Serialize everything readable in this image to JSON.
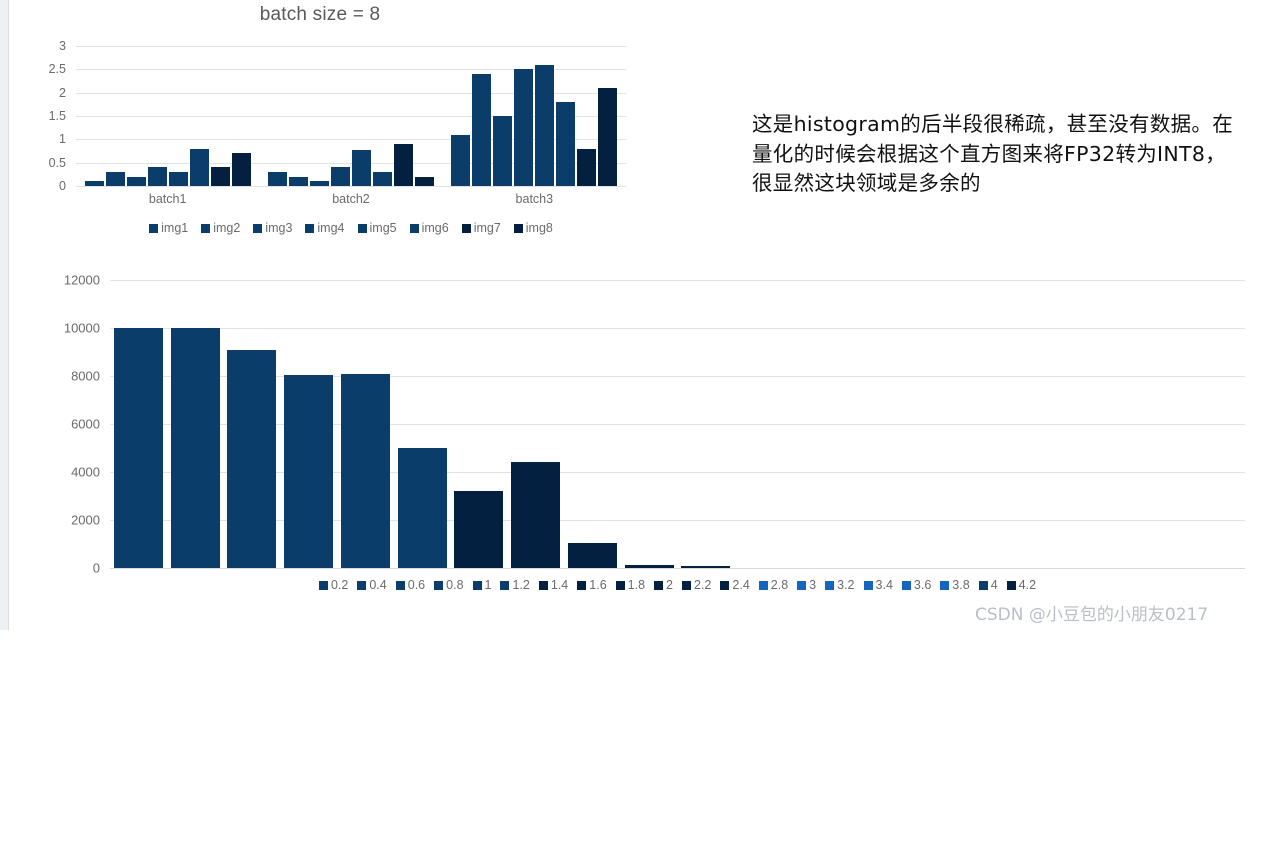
{
  "watermark": "CSDN @小豆包的小朋友0217",
  "annotation": {
    "text": "这是histogram的后半段很稀疏，甚至没有数据。在量化的时候会根据这个直方图来将FP32转为INT8，很显然这块领域是多余的"
  },
  "colors": {
    "bar_primary": "#0b3d6b",
    "bar_dark": "#032040",
    "bar_bright": "#1565c0",
    "axis_text": "#6b6b6b",
    "grid": "#e2e2e2",
    "title_text": "#595959",
    "watermark": "#b9bfc6"
  },
  "chart_data": [
    {
      "type": "bar",
      "id": "batch-chart",
      "title": "batch size = 8",
      "xlabel": "",
      "ylabel": "",
      "ylim": [
        0,
        3
      ],
      "yticks": [
        3,
        2.5,
        2,
        1.5,
        1,
        0.5,
        0
      ],
      "grid": true,
      "legend_position": "bottom",
      "categories": [
        "batch1",
        "batch2",
        "batch3"
      ],
      "series": [
        {
          "name": "img1",
          "color": "#0b3d6b",
          "values": [
            0.1,
            0.3,
            1.1
          ]
        },
        {
          "name": "img2",
          "color": "#0b3d6b",
          "values": [
            0.3,
            0.2,
            2.4
          ]
        },
        {
          "name": "img3",
          "color": "#0b3d6b",
          "values": [
            0.2,
            0.1,
            1.5
          ]
        },
        {
          "name": "img4",
          "color": "#0b3d6b",
          "values": [
            0.4,
            0.4,
            2.5
          ]
        },
        {
          "name": "img5",
          "color": "#0b3d6b",
          "values": [
            0.3,
            0.78,
            2.6
          ]
        },
        {
          "name": "img6",
          "color": "#0b3d6b",
          "values": [
            0.8,
            0.3,
            1.8
          ]
        },
        {
          "name": "img7",
          "color": "#032040",
          "values": [
            0.4,
            0.9,
            0.8
          ]
        },
        {
          "name": "img8",
          "color": "#032040",
          "values": [
            0.7,
            0.2,
            2.1
          ]
        }
      ]
    },
    {
      "type": "bar",
      "id": "histogram-chart",
      "title": "",
      "xlabel": "",
      "ylabel": "",
      "ylim": [
        0,
        12000
      ],
      "yticks": [
        12000,
        10000,
        8000,
        6000,
        4000,
        2000,
        0
      ],
      "grid": true,
      "legend_position": "bottom",
      "categories": [
        "0.2",
        "0.4",
        "0.6",
        "0.8",
        "1",
        "1.2",
        "1.4",
        "1.6",
        "1.8",
        "2",
        "2.2",
        "2.4",
        "2.8",
        "3",
        "3.2",
        "3.4",
        "3.6",
        "3.8",
        "4",
        "4.2"
      ],
      "values": [
        10000,
        10000,
        9100,
        8050,
        8100,
        5000,
        3200,
        4400,
        1050,
        130,
        70,
        0,
        0,
        0,
        0,
        0,
        0,
        0,
        0,
        0
      ],
      "bar_colors": [
        "#0b3d6b",
        "#0b3d6b",
        "#0b3d6b",
        "#0b3d6b",
        "#0b3d6b",
        "#0b3d6b",
        "#032040",
        "#032040",
        "#032040",
        "#032040",
        "#032040",
        "#032040",
        "#1565c0",
        "#1565c0",
        "#1565c0",
        "#1565c0",
        "#1565c0",
        "#1565c0",
        "#0b3d6b",
        "#032040"
      ]
    }
  ]
}
